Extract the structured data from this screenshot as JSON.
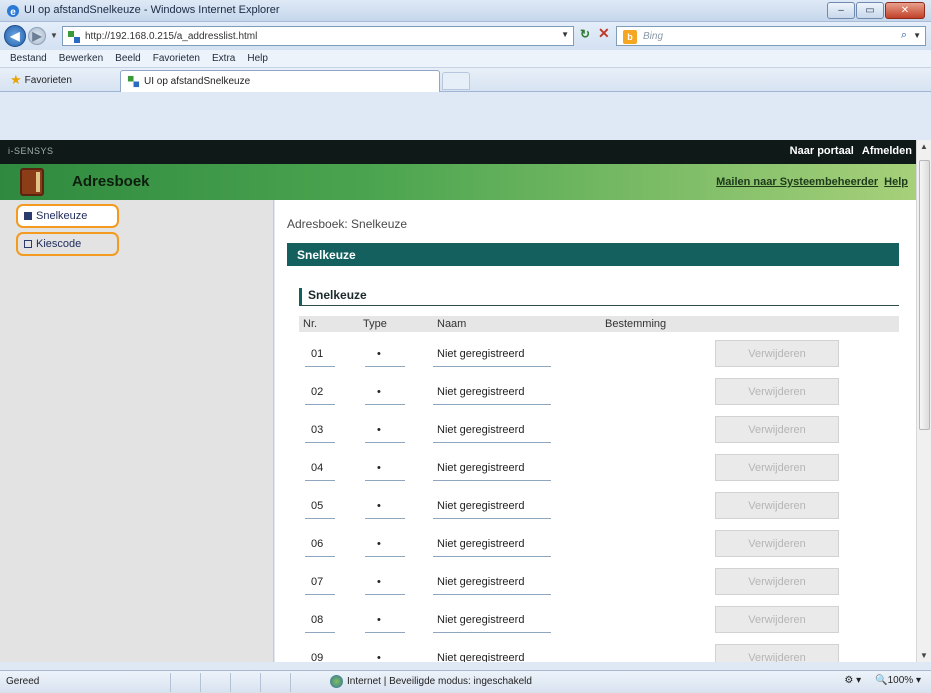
{
  "window": {
    "title": "UI op afstandSnelkeuze — Windows Internet Explorer",
    "title_short": "UI op afstandSnelkeuze",
    "title_suffix": " - Windows Internet Explorer",
    "buttons": [
      "–",
      "▭",
      "✕"
    ]
  },
  "browser": {
    "url": "http://192.168.0.215/a_addresslist.html",
    "search_placeholder": "Bing",
    "menu": [
      "Bestand",
      "Bewerken",
      "Beeld",
      "Favorieten",
      "Extra",
      "Help"
    ],
    "favorites_label": "Favorieten",
    "tab_title": "UI op afstandSnelkeuze"
  },
  "page": {
    "brand": "i-SENSYS",
    "header_links": [
      "Naar portaal",
      "Afmelden"
    ],
    "app_title": "Adresboek",
    "app_links": [
      "Mailen naar Systeembeheerder",
      "Help"
    ],
    "sidebar": [
      {
        "label": "Snelkeuze",
        "active": true
      },
      {
        "label": "Kiescode",
        "active": false
      }
    ],
    "breadcrumb": "Adresboek: Snelkeuze",
    "section_title": "Snelkeuze",
    "sub_title": "Snelkeuze",
    "columns": [
      "Nr.",
      "Type",
      "Naam",
      "Bestemming"
    ],
    "rows": [
      {
        "nr": "01",
        "type": "•",
        "naam": "Niet geregistreerd",
        "btn": "Verwijderen"
      },
      {
        "nr": "02",
        "type": "•",
        "naam": "Niet geregistreerd",
        "btn": "Verwijderen"
      },
      {
        "nr": "03",
        "type": "•",
        "naam": "Niet geregistreerd",
        "btn": "Verwijderen"
      },
      {
        "nr": "04",
        "type": "•",
        "naam": "Niet geregistreerd",
        "btn": "Verwijderen"
      },
      {
        "nr": "05",
        "type": "•",
        "naam": "Niet geregistreerd",
        "btn": "Verwijderen"
      },
      {
        "nr": "06",
        "type": "•",
        "naam": "Niet geregistreerd",
        "btn": "Verwijderen"
      },
      {
        "nr": "07",
        "type": "•",
        "naam": "Niet geregistreerd",
        "btn": "Verwijderen"
      },
      {
        "nr": "08",
        "type": "•",
        "naam": "Niet geregistreerd",
        "btn": "Verwijderen"
      },
      {
        "nr": "09",
        "type": "•",
        "naam": "Niet geregistreerd",
        "btn": "Verwijderen"
      }
    ]
  },
  "statusbar": {
    "status": "Gereed",
    "zone": "Internet | Beveiligde modus: ingeschakeld",
    "zoom": "100%"
  },
  "colors": {
    "header_dark": "#0f1a18",
    "green_bar": "#4aa44f",
    "section_teal": "#13605f",
    "highlight_orange": "#f39a1f"
  }
}
